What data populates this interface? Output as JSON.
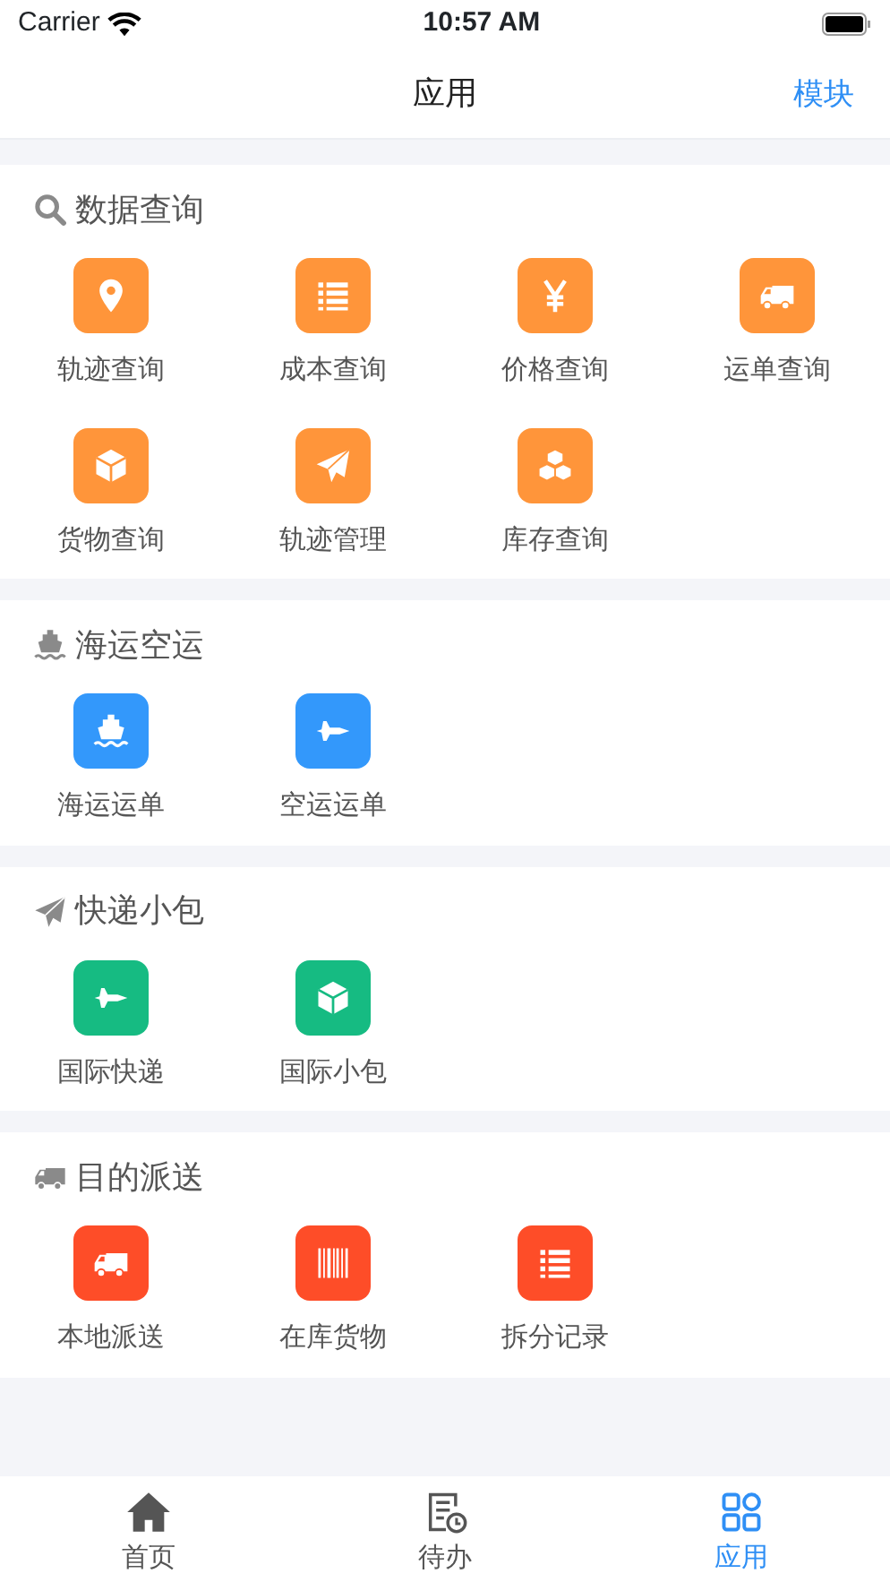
{
  "status_bar": {
    "carrier": "Carrier",
    "time": "10:57 AM"
  },
  "nav_bar": {
    "title": "应用",
    "action": "模块"
  },
  "sections": [
    {
      "title": "数据查询",
      "kind": "search",
      "color": "#ff953a",
      "items": [
        {
          "label": "轨迹查询",
          "kind": "pin"
        },
        {
          "label": "成本查询",
          "kind": "list"
        },
        {
          "label": "价格查询",
          "kind": "yen"
        },
        {
          "label": "运单查询",
          "kind": "truck"
        },
        {
          "label": "货物查询",
          "kind": "box"
        },
        {
          "label": "轨迹管理",
          "kind": "plane-paper"
        },
        {
          "label": "库存查询",
          "kind": "boxes"
        }
      ]
    },
    {
      "title": "海运空运",
      "kind": "ship",
      "color": "#3398fb",
      "items": [
        {
          "label": "海运运单",
          "kind": "ship"
        },
        {
          "label": "空运运单",
          "kind": "jet"
        }
      ]
    },
    {
      "title": "快递小包",
      "kind": "plane-paper",
      "color": "#16bb82",
      "items": [
        {
          "label": "国际快递",
          "kind": "jet"
        },
        {
          "label": "国际小包",
          "kind": "box"
        }
      ]
    },
    {
      "title": "目的派送",
      "kind": "truck",
      "color": "#fe4d28",
      "items": [
        {
          "label": "本地派送",
          "kind": "truck"
        },
        {
          "label": "在库货物",
          "kind": "barcode"
        },
        {
          "label": "拆分记录",
          "kind": "list"
        }
      ]
    }
  ],
  "tab_bar": [
    {
      "label": "首页",
      "kind": "home",
      "selected": false
    },
    {
      "label": "待办",
      "kind": "todo",
      "selected": false
    },
    {
      "label": "应用",
      "kind": "grid",
      "selected": true
    }
  ]
}
